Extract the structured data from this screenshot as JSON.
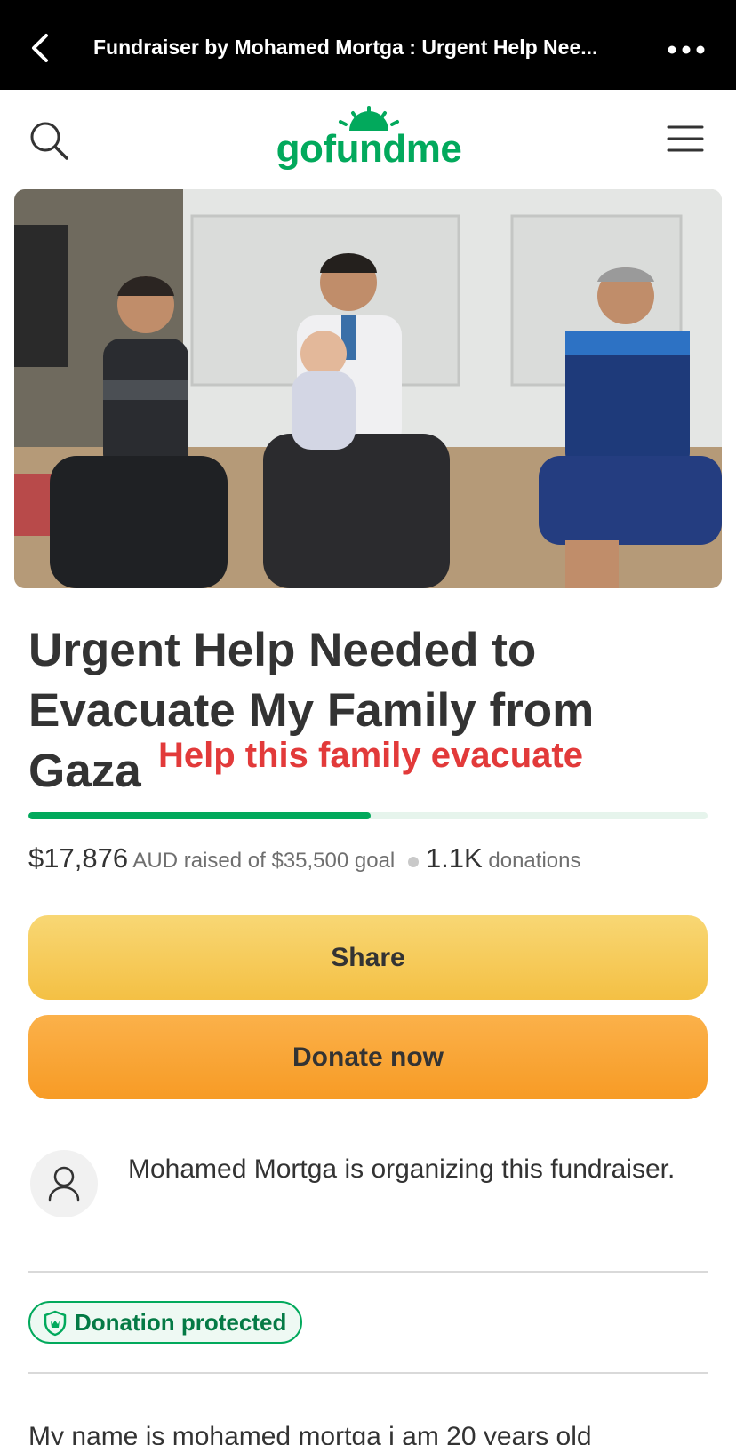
{
  "top_bar": {
    "title": "Fundraiser by Mohamed Mortga : Urgent Help Nee..."
  },
  "brand": {
    "logo_text": "gofundme",
    "accent_color": "#02a95c"
  },
  "icons": {
    "back": "chevron-left-icon",
    "more": "more-horizontal-icon",
    "search": "search-icon",
    "menu": "hamburger-menu-icon",
    "avatar": "user-icon",
    "shield": "shield-icon"
  },
  "fundraiser": {
    "title": "Urgent Help Needed to Evacuate My Family from Gaza",
    "overlay_caption": "Help this family evacuate",
    "raised_amount": "$17,876",
    "raised_suffix": "AUD raised of $35,500 goal",
    "donations_count": "1.1K",
    "donations_label": "donations",
    "progress_fraction": 0.5036
  },
  "actions": {
    "share_label": "Share",
    "donate_label": "Donate now"
  },
  "organizer": {
    "text": "Mohamed Mortga is organizing this fundraiser."
  },
  "protection": {
    "badge_label": "Donation protected"
  },
  "story": {
    "first_line": "My name is mohamed mortga i am 20 years old"
  },
  "colors": {
    "primary_button": "#f4c044",
    "donate_button": "#f79b25",
    "caption": "#e23a3a"
  }
}
